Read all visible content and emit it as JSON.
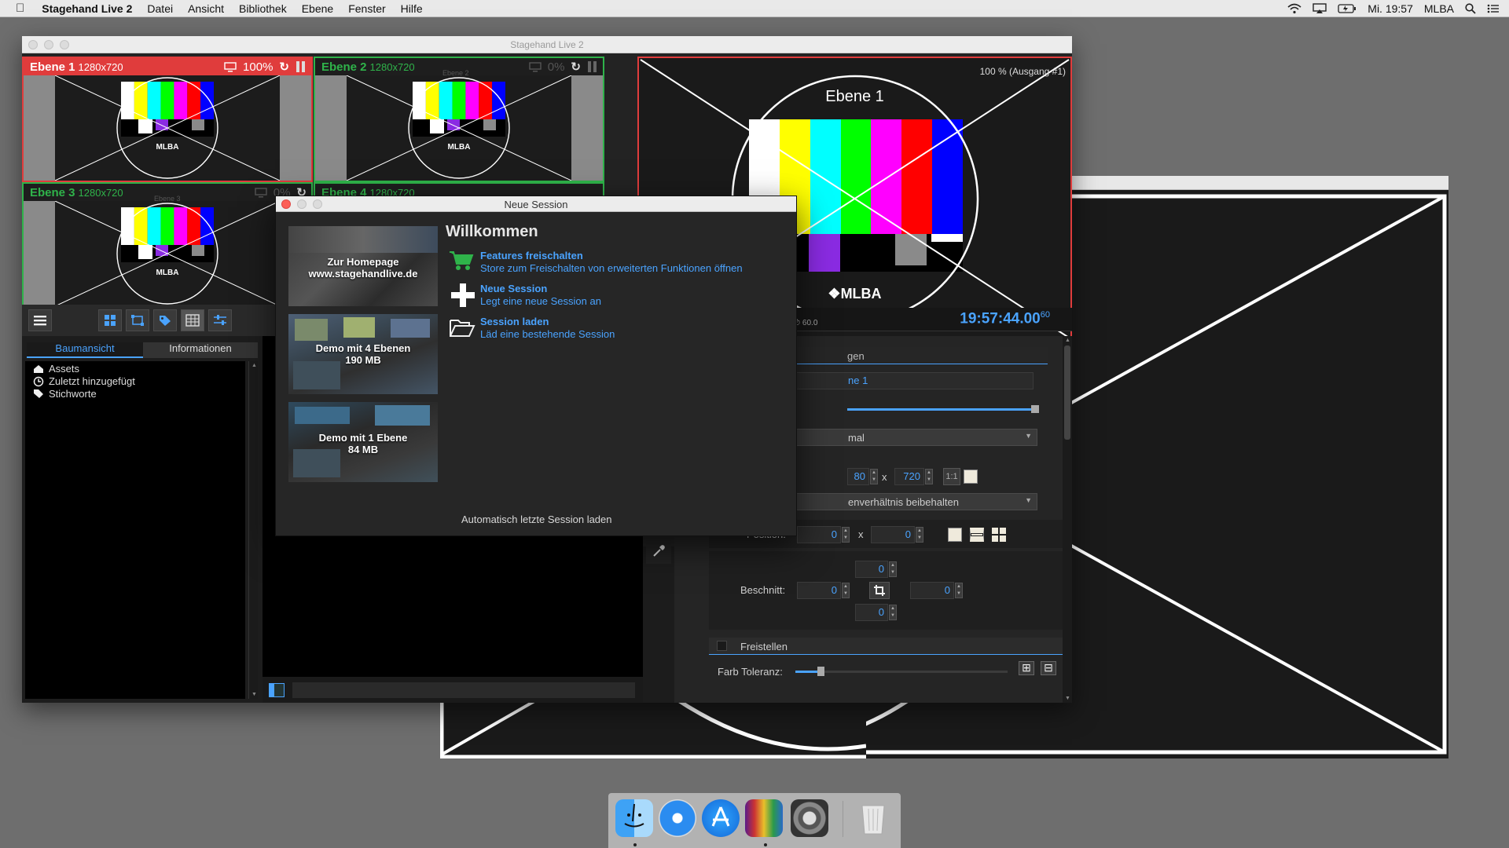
{
  "menubar": {
    "app": "Stagehand Live 2",
    "items": [
      "Datei",
      "Ansicht",
      "Bibliothek",
      "Ebene",
      "Fenster",
      "Hilfe"
    ],
    "clock": "Mi. 19:57",
    "user": "MLBA"
  },
  "main_window": {
    "title": "Stagehand Live 2"
  },
  "output_window": {},
  "layers": [
    {
      "name": "Ebene 1",
      "res": "1280x720",
      "pct": "100%",
      "color": "#e03c3c",
      "ghost": ""
    },
    {
      "name": "Ebene 2",
      "res": "1280x720",
      "pct": "0%",
      "color": "#2fb34a",
      "ghost": "Ebene 2"
    },
    {
      "name": "Ebene 3",
      "res": "1280x720",
      "pct": "0%",
      "color": "#2fb34a",
      "ghost": "Ebene 3"
    },
    {
      "name": "Ebene 4",
      "res": "1280x720",
      "pct": "",
      "color": "#2fb34a",
      "ghost": ""
    }
  ],
  "preview": {
    "label": "Ebene 1",
    "badge": "100 % (Ausgang #1)",
    "logo": "MLBA"
  },
  "test_logo": "MLBA",
  "timecode": {
    "value": "19:57:44.00",
    "frames": "60",
    "left_top": "et",
    "left_bottom": "0 ⏱ 60.0"
  },
  "browser": {
    "tabs": [
      "Baumansicht",
      "Informationen"
    ],
    "tree": [
      "Assets",
      "Zuletzt hinzugefügt",
      "Stichworte"
    ]
  },
  "inspector": {
    "section_partial": "gen",
    "layer_name_partial": "ne 1",
    "blend_partial": "mal",
    "width_partial": "80",
    "height": "720",
    "size_x": "x",
    "ratio_btn": "1:1",
    "scale_partial": "enverhältnis beibehalten",
    "position_label": "Position:",
    "pos_x": "0",
    "pos_y": "0",
    "pos_x_sep": "x",
    "crop_label": "Beschnitt:",
    "crop_top": "0",
    "crop_left": "0",
    "crop_right": "0",
    "crop_bottom": "0",
    "keying_label": "Freistellen",
    "tolerance_label": "Farb Toleranz:"
  },
  "dialog": {
    "title": "Neue Session",
    "welcome": "Willkommen",
    "thumbs": [
      {
        "line1": "Zur Homepage",
        "line2": "www.stagehandlive.de"
      },
      {
        "line1": "Demo mit 4 Ebenen",
        "line2": "190 MB"
      },
      {
        "line1": "Demo mit 1 Ebene",
        "line2": "84 MB"
      }
    ],
    "actions": [
      {
        "title": "Features freischalten",
        "desc": "Store zum Freischalten von erweiterten Funktionen öffnen",
        "icon": "cart-icon"
      },
      {
        "title": "Neue Session",
        "desc": "Legt eine neue Session an",
        "icon": "plus-icon"
      },
      {
        "title": "Session laden",
        "desc": "Läd eine bestehende Session",
        "icon": "folder-icon"
      }
    ],
    "auto_load": "Automatisch letzte Session laden"
  },
  "colors": {
    "accent": "#4aa3ff",
    "red": "#e03c3c",
    "green": "#2fb34a"
  }
}
